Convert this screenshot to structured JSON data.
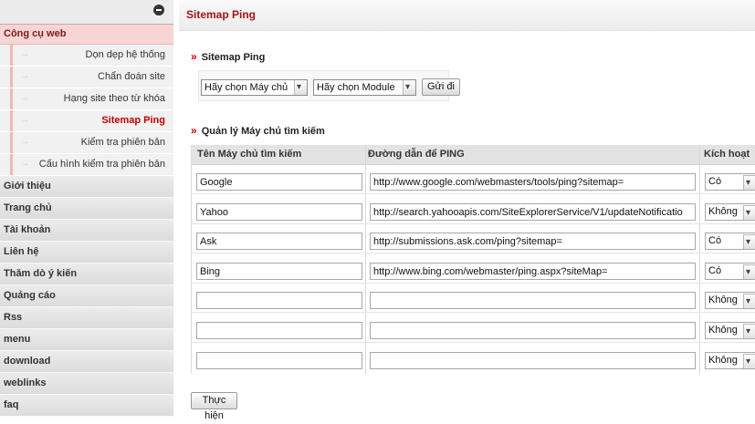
{
  "sidebar": {
    "header": "Công cụ web",
    "subitems": [
      {
        "label": "Dọn dẹp hệ thống"
      },
      {
        "label": "Chẩn đoán site"
      },
      {
        "label": "Hạng site theo từ khóa"
      },
      {
        "label": "Sitemap Ping",
        "active": true
      },
      {
        "label": "Kiểm tra phiên bản"
      },
      {
        "label": "Cấu hình kiểm tra phiên bản"
      }
    ],
    "modules": [
      {
        "label": "Giới thiệu"
      },
      {
        "label": "Trang chủ"
      },
      {
        "label": "Tài khoản"
      },
      {
        "label": "Liên hệ"
      },
      {
        "label": "Thăm dò ý kiến"
      },
      {
        "label": "Quảng cáo"
      },
      {
        "label": "Rss"
      },
      {
        "label": "menu"
      },
      {
        "label": "download"
      },
      {
        "label": "weblinks"
      },
      {
        "label": "faq"
      }
    ]
  },
  "main": {
    "title": "Sitemap Ping",
    "ping_section": {
      "title": "Sitemap Ping",
      "server_select": "Hãy chọn Máy chủ",
      "module_select": "Hãy chọn Module",
      "submit_label": "Gửi đi"
    },
    "manage_section": {
      "title": "Quản lý Máy chủ tìm kiếm",
      "columns": [
        "Tên Máy chủ tìm kiếm",
        "Đường dẫn để PING",
        "Kích hoạt"
      ],
      "rows": [
        {
          "name": "Google",
          "url": "http://www.google.com/webmasters/tools/ping?sitemap=",
          "active": "Có"
        },
        {
          "name": "Yahoo",
          "url": "http://search.yahooapis.com/SiteExplorerService/V1/updateNotificatio",
          "active": "Không"
        },
        {
          "name": "Ask",
          "url": "http://submissions.ask.com/ping?sitemap=",
          "active": "Có"
        },
        {
          "name": "Bing",
          "url": "http://www.bing.com/webmaster/ping.aspx?siteMap=",
          "active": "Có"
        },
        {
          "name": "",
          "url": "",
          "active": "Không"
        },
        {
          "name": "",
          "url": "",
          "active": "Không"
        },
        {
          "name": "",
          "url": "",
          "active": "Không"
        }
      ],
      "submit_label": "Thực hiện"
    }
  }
}
